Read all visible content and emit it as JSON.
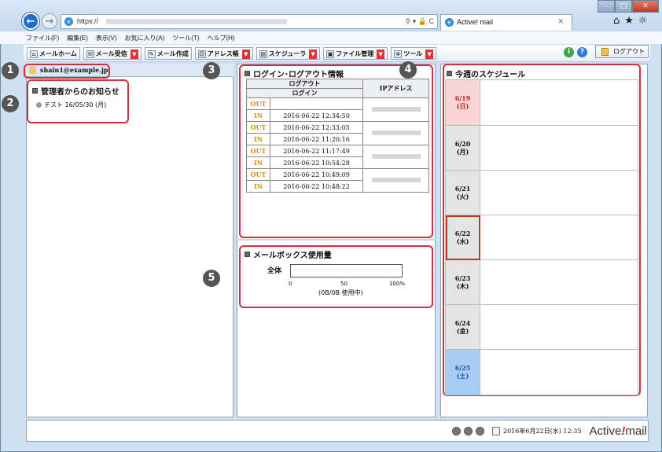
{
  "browser": {
    "url_prefix": "https://",
    "tab_title": "Active! mail",
    "menu": [
      "ファイル(F)",
      "編集(E)",
      "表示(V)",
      "お気に入り(A)",
      "ツール(T)",
      "ヘルプ(H)"
    ]
  },
  "toolbar": {
    "items": [
      "メールホーム",
      "メール受信",
      "メール作成",
      "アドレス帳",
      "スケジューラ",
      "ファイル管理",
      "ツール"
    ],
    "logout_label": "ログアウト"
  },
  "user": {
    "email": "shain1@example.jp"
  },
  "notices": {
    "title": "管理者からのお知らせ",
    "items": [
      "テスト 16/05/30 (月)"
    ]
  },
  "login_info": {
    "title": "ログイン･ログアウト情報",
    "header_out": "ログアウト",
    "header_in": "ログイン",
    "header_ip": "IPアドレス",
    "rows": [
      {
        "type": "OUT",
        "time": ""
      },
      {
        "type": "IN",
        "time": "2016-06-22 12:34:50"
      },
      {
        "type": "OUT",
        "time": "2016-06-22 12:33:05"
      },
      {
        "type": "IN",
        "time": "2016-06-22 11:20:16"
      },
      {
        "type": "OUT",
        "time": "2016-06-22 11:17:49"
      },
      {
        "type": "IN",
        "time": "2016-06-22 10:54:28"
      },
      {
        "type": "OUT",
        "time": "2016-06-22 10:49:09"
      },
      {
        "type": "IN",
        "time": "2016-06-22 10:48:22"
      }
    ]
  },
  "mailbox": {
    "title": "メールボックス使用量",
    "label": "全体",
    "usage_fraction": 0,
    "ticks": [
      "0",
      "50",
      "100%"
    ],
    "usage_text": "(0B/0B 使用中)"
  },
  "schedule": {
    "title": "今週のスケジュール",
    "days": [
      {
        "date": "6/19",
        "dow": "(日)",
        "kind": "sun"
      },
      {
        "date": "6/20",
        "dow": "(月)",
        "kind": "weekday"
      },
      {
        "date": "6/21",
        "dow": "(火)",
        "kind": "weekday"
      },
      {
        "date": "6/22",
        "dow": "(水)",
        "kind": "today"
      },
      {
        "date": "6/23",
        "dow": "(木)",
        "kind": "weekday"
      },
      {
        "date": "6/24",
        "dow": "(金)",
        "kind": "weekday"
      },
      {
        "date": "6/25",
        "dow": "(土)",
        "kind": "sat"
      }
    ]
  },
  "footer": {
    "datetime": "2016年6月22日(水) 12:35",
    "brand_a": "Active",
    "brand_b": "!",
    "brand_c": "mail"
  },
  "callouts": [
    "1",
    "2",
    "3",
    "4",
    "5"
  ],
  "colors": {
    "callout_border": "#d12f3e",
    "sunday_bg": "#f9d6d6",
    "saturday_bg": "#a8ccf3",
    "weekday_bg": "#e4e4e4"
  }
}
